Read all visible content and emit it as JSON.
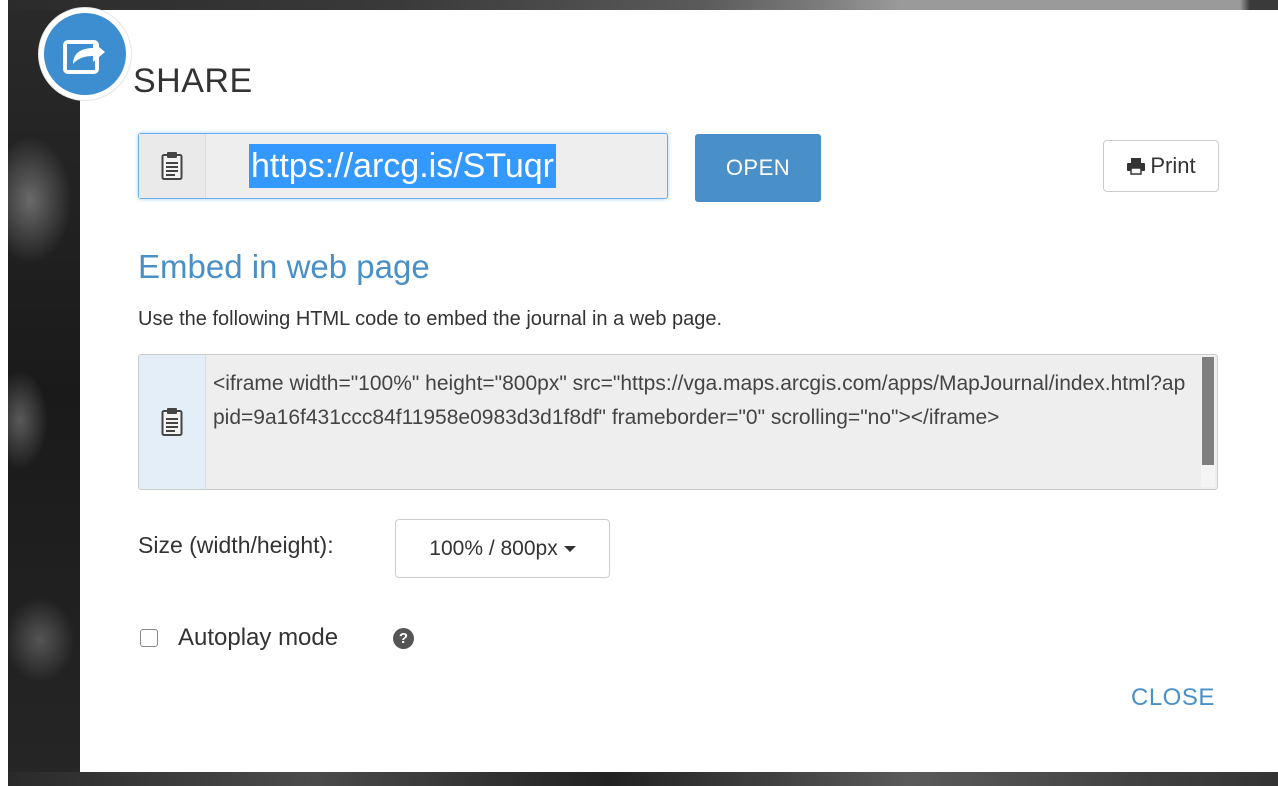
{
  "dialog": {
    "title": "SHARE",
    "icon": "share-icon"
  },
  "short_link": {
    "copy_icon": "clipboard-icon",
    "url": "https://arcg.is/STuqr",
    "open_label": "OPEN",
    "print_label": "Print",
    "print_icon": "printer-icon"
  },
  "embed": {
    "heading": "Embed in web page",
    "description": "Use the following HTML code to embed the journal in a web page.",
    "copy_icon": "clipboard-icon",
    "code": "<iframe width=\"100%\" height=\"800px\" src=\"https://vga.maps.arcgis.com/apps/MapJournal/index.html?appid=9a16f431ccc84f11958e0983d3d1f8df\" frameborder=\"0\" scrolling=\"no\"></iframe>"
  },
  "size": {
    "label": "Size (width/height):",
    "selected": "100% / 800px"
  },
  "autoplay": {
    "label": "Autoplay mode",
    "checked": false,
    "help_icon": "question-circle-icon",
    "help_glyph": "?"
  },
  "footer": {
    "close_label": "CLOSE"
  },
  "colors": {
    "accent": "#4a90c8",
    "badge": "#3d8ed1",
    "selection": "#3399ff"
  }
}
